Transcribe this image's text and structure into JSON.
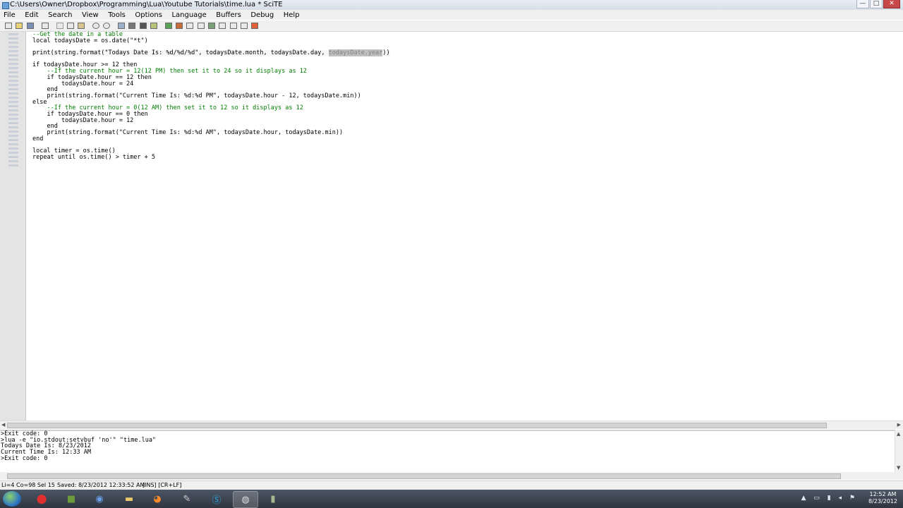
{
  "window": {
    "title": "C:\\Users\\Owner\\Dropbox\\Programming\\Lua\\Youtube Tutorials\\time.lua * SciTE",
    "buttons": {
      "minimize": "—",
      "maximize": "□",
      "close": "✕"
    }
  },
  "menu": [
    "File",
    "Edit",
    "Search",
    "View",
    "Tools",
    "Options",
    "Language",
    "Buffers",
    "Debug",
    "Help"
  ],
  "toolbar": {
    "icons": [
      "new-icon",
      "open-icon",
      "save-icon",
      "print-icon",
      "cut-icon",
      "copy-icon",
      "paste-icon",
      "undo-icon",
      "redo-icon",
      "find-icon",
      "replace-icon",
      "compile-icon",
      "build-icon",
      "go-icon",
      "stop-icon",
      "tools-icon",
      "next-message-icon",
      "prev-message-icon",
      "clear-output-icon",
      "fold-icon",
      "unfold-icon",
      "close-icon"
    ]
  },
  "editor": {
    "lines": [
      {
        "text": "--Get the date in a table",
        "kind": "comment"
      },
      {
        "text": "local todaysDate = os.date(\"*t\")",
        "kind": "code"
      },
      {
        "text": "",
        "kind": "code"
      },
      {
        "pre": "print(string.format(\"Todays Date Is: %d/%d/%d\", todaysDate.month, todaysDate.day, ",
        "sel": "todaysDate.year",
        "post": "))",
        "kind": "current"
      },
      {
        "text": "",
        "kind": "code"
      },
      {
        "text": "if todaysDate.hour >= 12 then",
        "kind": "code"
      },
      {
        "text": "    --If the current hour = 12(12 PM) then set it to 24 so it displays as 12",
        "kind": "comment"
      },
      {
        "text": "    if todaysDate.hour == 12 then",
        "kind": "code"
      },
      {
        "text": "        todaysDate.hour = 24",
        "kind": "code"
      },
      {
        "text": "    end",
        "kind": "code"
      },
      {
        "text": "    print(string.format(\"Current Time Is: %d:%d PM\", todaysDate.hour - 12, todaysDate.min))",
        "kind": "code"
      },
      {
        "text": "else",
        "kind": "code"
      },
      {
        "text": "    --If the current hour = 0(12 AM) then set it to 12 so it displays as 12",
        "kind": "comment"
      },
      {
        "text": "    if todaysDate.hour == 0 then",
        "kind": "code"
      },
      {
        "text": "        todaysDate.hour = 12",
        "kind": "code"
      },
      {
        "text": "    end",
        "kind": "code"
      },
      {
        "text": "    print(string.format(\"Current Time Is: %d:%d AM\", todaysDate.hour, todaysDate.min))",
        "kind": "code"
      },
      {
        "text": "end",
        "kind": "code"
      },
      {
        "text": "",
        "kind": "code"
      },
      {
        "text": "local timer = os.time()",
        "kind": "code"
      },
      {
        "text": "repeat until os.time() > timer + 5",
        "kind": "code"
      }
    ]
  },
  "output": {
    "lines": [
      ">Exit code: 0",
      ">lua -e \"io.stdout:setvbuf 'no'\" \"time.lua\"",
      "Todays Date Is: 8/23/2012",
      "Current Time Is: 12:33 AM",
      ">Exit code: 0"
    ]
  },
  "status": {
    "position": "Li=4 Co=98 Sel 15",
    "saved": "Saved: 8/23/2012 12:33:52 AM",
    "mode": "[INS] [CR+LF]"
  },
  "taskbar": {
    "clock_time": "12:52 AM",
    "clock_date": "8/23/2012"
  }
}
